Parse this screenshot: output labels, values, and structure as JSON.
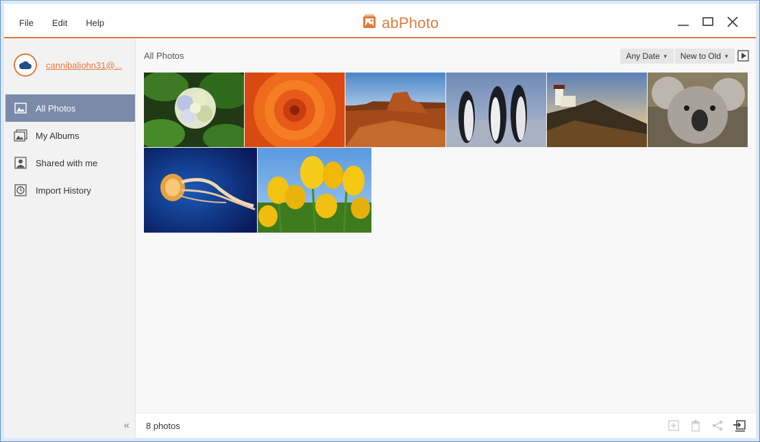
{
  "menu": [
    "File",
    "Edit",
    "Help"
  ],
  "app": {
    "title": "abPhoto",
    "accent": "#e07a3c"
  },
  "account": {
    "name": "cannibaljohn31@..."
  },
  "sidebar": {
    "items": [
      {
        "label": "All Photos",
        "icon": "photo-icon",
        "active": true
      },
      {
        "label": "My Albums",
        "icon": "albums-icon",
        "active": false
      },
      {
        "label": "Shared with me",
        "icon": "shared-user-icon",
        "active": false
      },
      {
        "label": "Import History",
        "icon": "history-clock-icon",
        "active": false
      }
    ],
    "collapse": "«"
  },
  "main": {
    "title": "All Photos",
    "date_filter": "Any Date",
    "sort": "New to Old"
  },
  "photos": [
    {
      "subject": "hydrangea"
    },
    {
      "subject": "orange-flower"
    },
    {
      "subject": "desert"
    },
    {
      "subject": "penguins"
    },
    {
      "subject": "lighthouse"
    },
    {
      "subject": "koala"
    },
    {
      "subject": "jellyfish"
    },
    {
      "subject": "tulips"
    }
  ],
  "status": {
    "count": "8 photos"
  }
}
